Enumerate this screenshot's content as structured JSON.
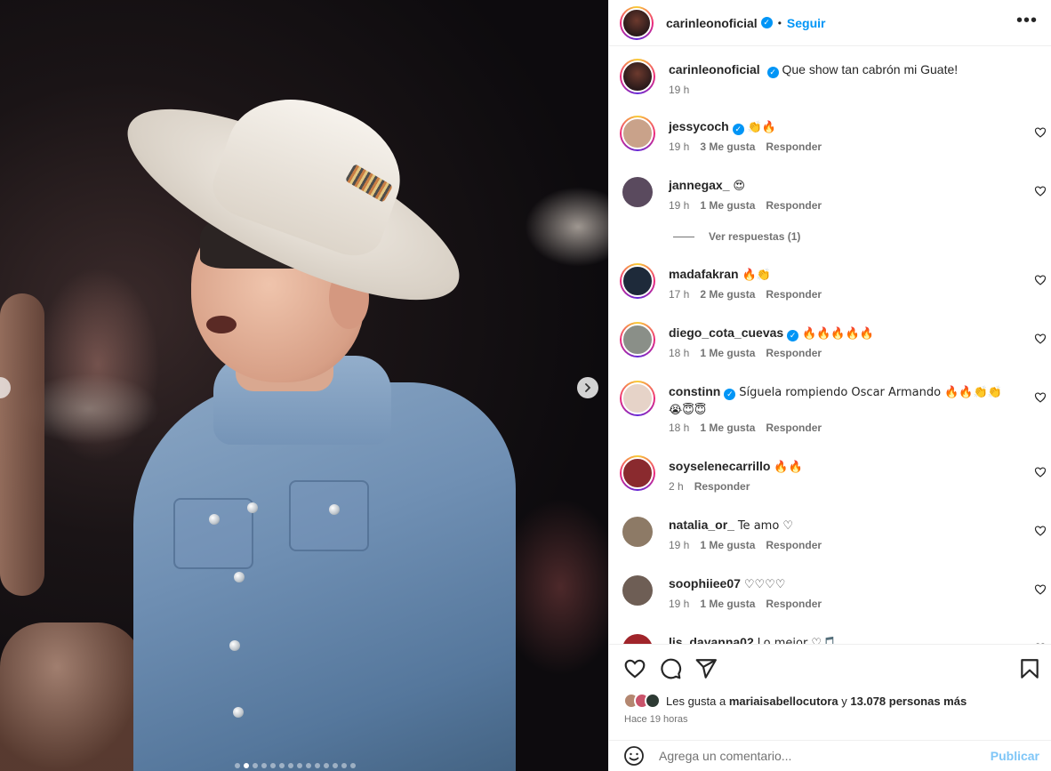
{
  "post": {
    "author": "carinleonoficial",
    "follow_label": "Seguir",
    "separator": "•",
    "caption": "Que show tan cabrón mi Guate!",
    "caption_time": "19 h"
  },
  "comments": [
    {
      "user": "jessycoch",
      "verified": true,
      "text": "👏🔥",
      "time": "19 h",
      "likes": "3 Me gusta",
      "reply": "Responder",
      "ring": true,
      "avatar_color": "#c9a28a"
    },
    {
      "user": "jannegax_",
      "verified": false,
      "text": "😍",
      "time": "19 h",
      "likes": "1 Me gusta",
      "reply": "Responder",
      "ring": false,
      "avatar_color": "#5a4a5e"
    },
    {
      "user": "madafakran",
      "verified": false,
      "text": "🔥👏",
      "time": "17 h",
      "likes": "2 Me gusta",
      "reply": "Responder",
      "ring": true,
      "avatar_color": "#1e2a3a"
    },
    {
      "user": "diego_cota_cuevas",
      "verified": true,
      "text": "🔥🔥🔥🔥🔥",
      "time": "18 h",
      "likes": "1 Me gusta",
      "reply": "Responder",
      "ring": true,
      "avatar_color": "#8a8f88"
    },
    {
      "user": "constinn",
      "verified": true,
      "text": "Síguela rompiendo Oscar Armando 🔥🔥👏👏😭😇😇",
      "time": "18 h",
      "likes": "1 Me gusta",
      "reply": "Responder",
      "ring": true,
      "avatar_color": "#e6d3c8"
    },
    {
      "user": "soyselenecarrillo",
      "verified": false,
      "text": "🔥🔥",
      "time": "2 h",
      "likes": "",
      "reply": "Responder",
      "ring": true,
      "avatar_color": "#8a2a2e"
    },
    {
      "user": "natalia_or_",
      "verified": false,
      "text": "Te amo ♡",
      "time": "19 h",
      "likes": "1 Me gusta",
      "reply": "Responder",
      "ring": false,
      "avatar_color": "#8d7a66"
    },
    {
      "user": "soophiiee07",
      "verified": false,
      "text": "♡♡♡♡",
      "time": "19 h",
      "likes": "1 Me gusta",
      "reply": "Responder",
      "ring": false,
      "avatar_color": "#6e5e55"
    },
    {
      "user": "lis_dayanna02",
      "verified": false,
      "text": "Lo mejor ♡🎵",
      "time": "",
      "likes": "",
      "reply": "",
      "ring": false,
      "avatar_color": "#a0242a"
    }
  ],
  "view_replies": "Ver respuestas (1)",
  "likes": {
    "prefix": "Les gusta a ",
    "user": "mariaisabellocutora",
    "middle": " y ",
    "count": "13.078 personas más"
  },
  "posted_ago": "Hace 19 horas",
  "add_comment": {
    "placeholder": "Agrega un comentario...",
    "publish": "Publicar"
  },
  "carousel": {
    "slides": 14,
    "current": 2
  },
  "colors": {
    "link": "#0095f6",
    "publish_disabled": "#7fc6f7",
    "muted": "#737373"
  }
}
